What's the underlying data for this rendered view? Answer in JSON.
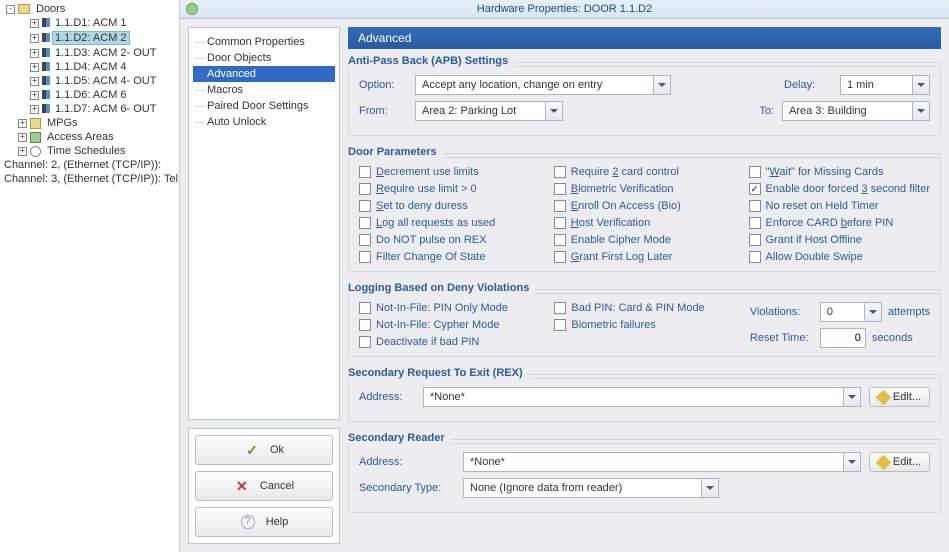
{
  "tree": {
    "doors_label": "Doors",
    "items": [
      {
        "label": "1.1.D1: ACM 1"
      },
      {
        "label": "1.1.D2: ACM 2",
        "selected": true
      },
      {
        "label": "1.1.D3: ACM 2- OUT"
      },
      {
        "label": "1.1.D4: ACM 4"
      },
      {
        "label": "1.1.D5: ACM 4- OUT"
      },
      {
        "label": "1.1.D6: ACM 6"
      },
      {
        "label": "1.1.D7: ACM 6- OUT"
      }
    ],
    "mpgs": "MPGs",
    "areas": "Access Areas",
    "sched": "Time Schedules",
    "ch2": "Channel: 2, (Ethernet (TCP/IP)):",
    "ch3": "Channel: 3, (Ethernet (TCP/IP)): Tel"
  },
  "window_title": "Hardware Properties: DOOR 1.1.D2",
  "nav": {
    "items": [
      "Common Properties",
      "Door Objects",
      "Advanced",
      "Macros",
      "Paired Door Settings",
      "Auto Unlock"
    ],
    "selected": "Advanced"
  },
  "buttons": {
    "ok": "Ok",
    "cancel": "Cancel",
    "help": "Help"
  },
  "page_header": "Advanced",
  "apb": {
    "title": "Anti-Pass Back (APB) Settings",
    "option_lbl": "Option:",
    "option_val": "Accept any location, change on entry",
    "delay_lbl": "Delay:",
    "delay_val": "1 min",
    "from_lbl": "From:",
    "from_val": "Area 2: Parking Lot",
    "to_lbl": "To:",
    "to_val": "Area 3: Building"
  },
  "params": {
    "title": "Door Parameters",
    "col1": [
      {
        "label": "Decrement use limits",
        "u": "D",
        "rest": "ecrement use limits"
      },
      {
        "label": "Require use limit > 0",
        "u": "R",
        "rest": "equire use limit > 0"
      },
      {
        "label": "Set to deny duress",
        "u": "S",
        "rest": "et to deny duress"
      },
      {
        "label": "Log all requests as used",
        "u": "L",
        "rest": "og all requests as used"
      },
      {
        "label": "Do NOT pulse on REX"
      },
      {
        "label": "Filter Change Of State"
      }
    ],
    "col2": [
      {
        "label": "Require 2 card control",
        "pre": "Require ",
        "u": "2",
        "rest": " card control"
      },
      {
        "label": "Biometric Verification",
        "u": "B",
        "rest": "iometric Verification"
      },
      {
        "label": "Enroll On Access (Bio)",
        "u": "E",
        "rest": "nroll On Access (Bio)"
      },
      {
        "label": "Host Verification",
        "u": "H",
        "rest": "ost Verification"
      },
      {
        "label": "Enable Cipher Mode"
      },
      {
        "label": "Grant First Log Later",
        "u": "G",
        "rest": "rant First Log Later"
      }
    ],
    "col3": [
      {
        "label": "\"Wait\" for Missing Cards",
        "pre": "\"",
        "u": "W",
        "rest": "ait\" for Missing Cards"
      },
      {
        "label": "Enable door forced 3 second filter",
        "checked": true,
        "pre": "Enable door forced ",
        "u": "3",
        "rest": " second filter"
      },
      {
        "label": "No reset on Held Timer"
      },
      {
        "label": "Enforce CARD before PIN",
        "pre": "Enforce CARD ",
        "u": "b",
        "rest": "efore PIN"
      },
      {
        "label": "Grant if Host Offline"
      },
      {
        "label": "Allow Double Swipe"
      }
    ]
  },
  "logging": {
    "title": "Logging Based on Deny Violations",
    "left": [
      "Not-In-File: PIN Only Mode",
      "Not-In-File: Cypher Mode",
      "Deactivate if bad PIN"
    ],
    "mid": [
      "Bad PIN: Card & PIN Mode",
      "Biometric failures"
    ],
    "viol_lbl": "Violations:",
    "viol_val": "0",
    "viol_suffix": "attempts",
    "reset_lbl": "Reset Time:",
    "reset_val": "0",
    "reset_suffix": "seconds"
  },
  "rex": {
    "title": "Secondary Request To Exit (REX)",
    "addr_lbl": "Address:",
    "addr_val": "*None*",
    "edit": "Edit..."
  },
  "reader": {
    "title": "Secondary Reader",
    "addr_lbl": "Address:",
    "addr_val": "*None*",
    "type_lbl": "Secondary Type:",
    "type_val": "None (Ignore data from reader)",
    "edit": "Edit..."
  }
}
